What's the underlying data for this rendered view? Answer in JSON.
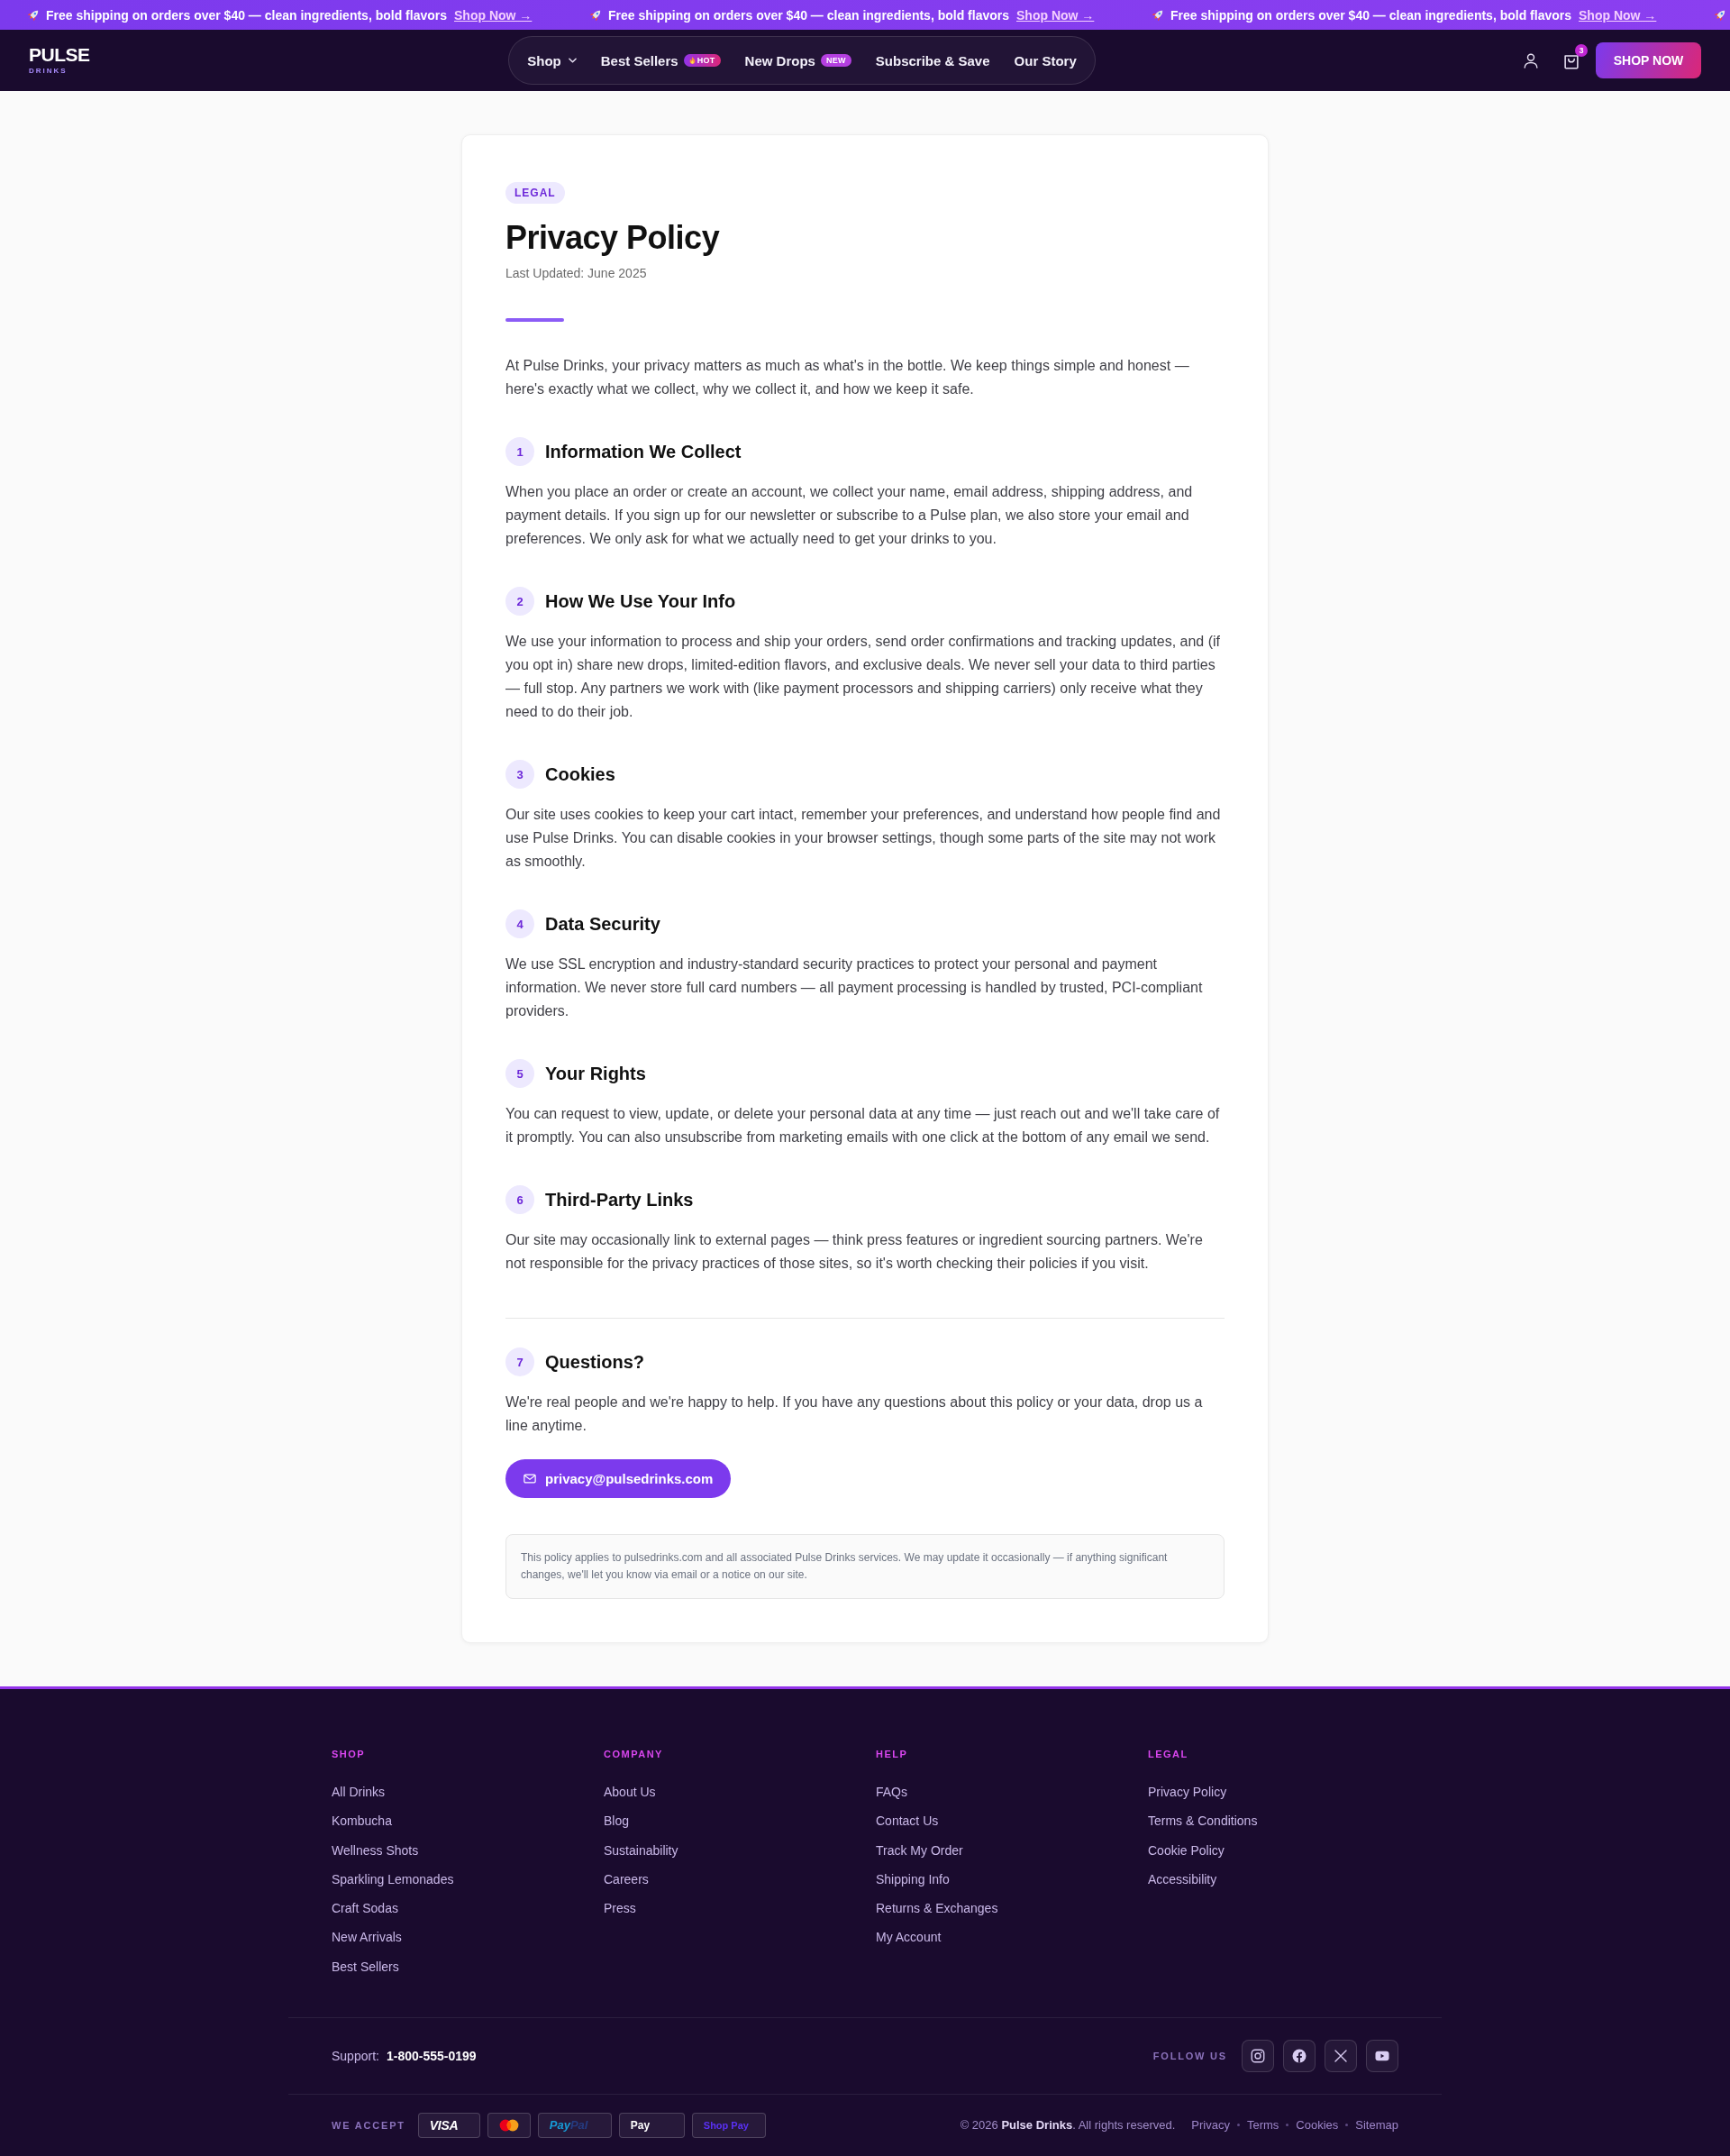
{
  "announcement_bar": {
    "items": [
      {
        "text": "Free shipping on orders over $40 — clean ingredients, bold flavors",
        "link": "Shop Now →"
      },
      {
        "text": "Free shipping on orders over $40 — clean ingredients, bold flavors",
        "link": "Shop Now →"
      },
      {
        "text": "Free shipping on orders over $40 — clean ingredients, bold flavors",
        "link": "Shop Now →"
      }
    ]
  },
  "header": {
    "logo": {
      "name": "PULSE",
      "tagline": "DRINKS"
    },
    "nav": [
      {
        "label": "Shop",
        "kind": "menu"
      },
      {
        "label": "Best Sellers",
        "kind": "link",
        "badge": {
          "kind": "hot",
          "text": "HOT"
        }
      },
      {
        "label": "New Drops",
        "kind": "link",
        "badge": {
          "kind": "new",
          "text": "NEW"
        }
      },
      {
        "label": "Subscribe & Save",
        "kind": "link"
      },
      {
        "label": "Our Story",
        "kind": "link"
      }
    ],
    "cart_count": "3",
    "cta": "SHOP NOW"
  },
  "policy": {
    "tag": "LEGAL",
    "title": "Privacy Policy",
    "updated": "Last Updated: June 2025",
    "intro": "At Pulse Drinks, your privacy matters as much as what's in the bottle. We keep things simple and honest — here's exactly what we collect, why we collect it, and how we keep it safe.",
    "sections": [
      {
        "number": "1",
        "title": "Information We Collect",
        "body": "When you place an order or create an account, we collect your name, email address, shipping address, and payment details. If you sign up for our newsletter or subscribe to a Pulse plan, we also store your email and preferences. We only ask for what we actually need to get your drinks to you."
      },
      {
        "number": "2",
        "title": "How We Use Your Info",
        "body": "We use your information to process and ship your orders, send order confirmations and tracking updates, and (if you opt in) share new drops, limited-edition flavors, and exclusive deals. We never sell your data to third parties — full stop. Any partners we work with (like payment processors and shipping carriers) only receive what they need to do their job."
      },
      {
        "number": "3",
        "title": "Cookies",
        "body": "Our site uses cookies to keep your cart intact, remember your preferences, and understand how people find and use Pulse Drinks. You can disable cookies in your browser settings, though some parts of the site may not work as smoothly."
      },
      {
        "number": "4",
        "title": "Data Security",
        "body": "We use SSL encryption and industry-standard security practices to protect your personal and payment information. We never store full card numbers — all payment processing is handled by trusted, PCI-compliant providers."
      },
      {
        "number": "5",
        "title": "Your Rights",
        "body": "You can request to view, update, or delete your personal data at any time — just reach out and we'll take care of it promptly. You can also unsubscribe from marketing emails with one click at the bottom of any email we send."
      },
      {
        "number": "6",
        "title": "Third-Party Links",
        "body": "Our site may occasionally link to external pages — think press features or ingredient sourcing partners. We're not responsible for the privacy practices of those sites, so it's worth checking their policies if you visit."
      }
    ],
    "contact": {
      "number": "7",
      "title": "Questions?",
      "body": "We're real people and we're happy to help. If you have any questions about this policy or your data, drop us a line anytime.",
      "email": "privacy@pulsedrinks.com"
    },
    "notice": "This policy applies to pulsedrinks.com and all associated Pulse Drinks services. We may update it occasionally — if anything significant changes, we'll let you know via email or a notice on our site."
  },
  "footer": {
    "columns": [
      {
        "heading": "SHOP",
        "links": [
          "All Drinks",
          "Kombucha",
          "Wellness Shots",
          "Sparkling Lemonades",
          "Craft Sodas",
          "New Arrivals",
          "Best Sellers"
        ]
      },
      {
        "heading": "COMPANY",
        "links": [
          "About Us",
          "Blog",
          "Sustainability",
          "Careers",
          "Press"
        ]
      },
      {
        "heading": "HELP",
        "links": [
          "FAQs",
          "Contact Us",
          "Track My Order",
          "Shipping Info",
          "Returns & Exchanges",
          "My Account"
        ]
      },
      {
        "heading": "LEGAL",
        "links": [
          "Privacy Policy",
          "Terms & Conditions",
          "Cookie Policy",
          "Accessibility"
        ]
      }
    ],
    "support": {
      "label": "Support:",
      "phone": "1-800-555-0199"
    },
    "follow_label": "FOLLOW US",
    "socials": [
      {
        "kind": "instagram"
      },
      {
        "kind": "facebook"
      },
      {
        "kind": "x"
      },
      {
        "kind": "youtube"
      }
    ],
    "accept_label": "WE ACCEPT",
    "payments": [
      {
        "kind": "visa",
        "text": "VISA"
      },
      {
        "kind": "mastercard"
      },
      {
        "kind": "paypal",
        "parts": [
          "Pay",
          "Pal"
        ]
      },
      {
        "kind": "applepay",
        "text": "Pay"
      },
      {
        "kind": "shoppay",
        "text": "Shop Pay"
      }
    ],
    "copyright": "© 2026 **Pulse Drinks**. All rights reserved.",
    "legal_links": [
      "Privacy",
      "Terms",
      "Cookies",
      "Sitemap"
    ]
  }
}
